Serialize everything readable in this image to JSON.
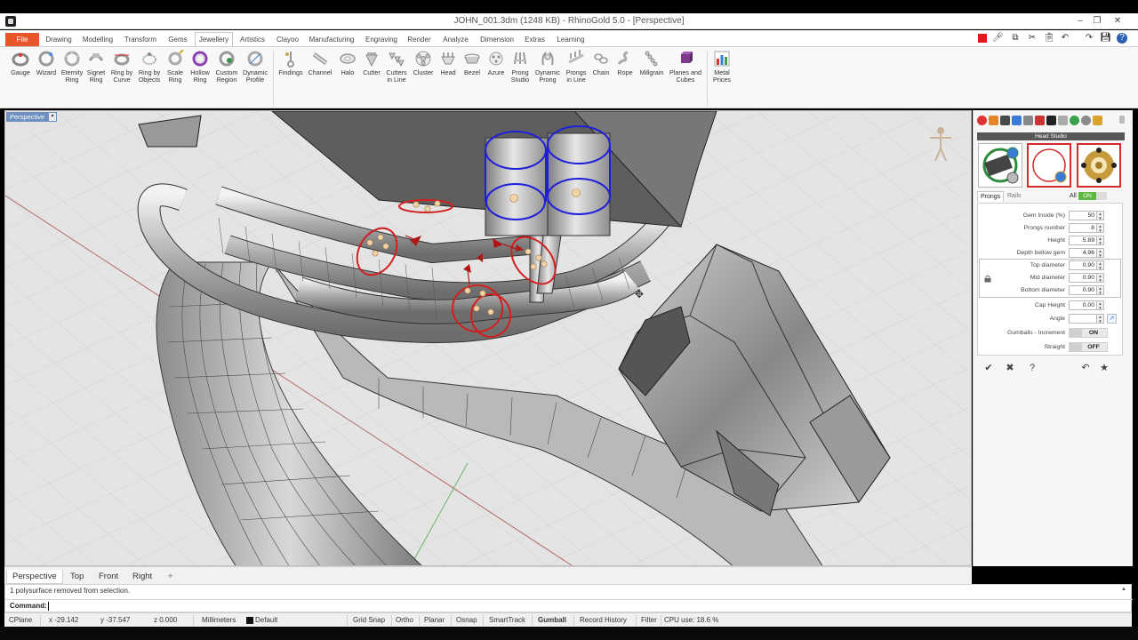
{
  "window": {
    "title": "JOHN_001.3dm (1248 KB) - RhinoGold 5.0 - [Perspective]",
    "min": "–",
    "max": "❐",
    "close": "✕"
  },
  "menu": {
    "file": "File",
    "tabs": [
      "Drawing",
      "Modelling",
      "Transform",
      "Gems",
      "Jewellery",
      "Artistics",
      "Clayoo",
      "Manufacturing",
      "Engraving",
      "Render",
      "Analyze",
      "Dimension",
      "Extras",
      "Learning"
    ],
    "active_tab": "Jewellery",
    "right_icons": [
      "stop-icon",
      "mic-icon",
      "copy-icon",
      "cut-icon",
      "paste-icon",
      "undo-icon",
      "redo-icon",
      "save-icon",
      "help-icon"
    ]
  },
  "ribbon": {
    "groups": [
      {
        "items": [
          {
            "l1": "Gauge",
            "l2": ""
          },
          {
            "l1": "Wizard",
            "l2": ""
          },
          {
            "l1": "Eternity",
            "l2": "Ring"
          },
          {
            "l1": "Signet",
            "l2": "Ring"
          },
          {
            "l1": "Ring by",
            "l2": "Curve"
          },
          {
            "l1": "Ring by",
            "l2": "Objects"
          },
          {
            "l1": "Scale",
            "l2": "Ring"
          },
          {
            "l1": "Hollow",
            "l2": "Ring"
          },
          {
            "l1": "Custom",
            "l2": "Region"
          },
          {
            "l1": "Dynamic",
            "l2": "Profile"
          }
        ]
      },
      {
        "items": [
          {
            "l1": "Findings",
            "l2": ""
          },
          {
            "l1": "Channel",
            "l2": ""
          },
          {
            "l1": "Halo",
            "l2": ""
          },
          {
            "l1": "Cutter",
            "l2": ""
          },
          {
            "l1": "Cutters",
            "l2": "in Line"
          },
          {
            "l1": "Cluster",
            "l2": ""
          },
          {
            "l1": "Head",
            "l2": ""
          },
          {
            "l1": "Bezel",
            "l2": ""
          },
          {
            "l1": "Azure",
            "l2": ""
          },
          {
            "l1": "Prong",
            "l2": "Studio"
          },
          {
            "l1": "Dynamic",
            "l2": "Prong"
          },
          {
            "l1": "Prongs",
            "l2": "in Line"
          },
          {
            "l1": "Chain",
            "l2": ""
          },
          {
            "l1": "Rope",
            "l2": ""
          },
          {
            "l1": "Millgrain",
            "l2": ""
          },
          {
            "l1": "Planes and",
            "l2": "Cubes"
          }
        ]
      },
      {
        "items": [
          {
            "l1": "Metal",
            "l2": "Prices"
          }
        ]
      }
    ]
  },
  "viewport": {
    "label": "Perspective",
    "dropdown": "▾"
  },
  "panel": {
    "title": "Head Studio",
    "tabs": [
      "Prongs",
      "Rails"
    ],
    "all_label": "All",
    "all_state": "ON",
    "fields": [
      {
        "label": "Gem Inside (%)",
        "value": "50"
      },
      {
        "label": "Prongs number",
        "value": "8"
      },
      {
        "label": "Height",
        "value": "5.89"
      },
      {
        "label": "Depth bellow gem",
        "value": "4.96"
      },
      {
        "label": "Top diameter",
        "value": "0.90"
      },
      {
        "label": "Mid diameter",
        "value": "0.90"
      },
      {
        "label": "Bottom diameter",
        "value": "0.90"
      },
      {
        "label": "Cap Height",
        "value": "0.00"
      },
      {
        "label": "Angle",
        "value": ""
      }
    ],
    "toggles": [
      {
        "label": "Gumballs - Increment",
        "value": "ON"
      },
      {
        "label": "Straight",
        "value": "OFF"
      }
    ],
    "actions": [
      "✔",
      "✖",
      "?",
      "↶",
      "★"
    ]
  },
  "view_tabs": [
    "Perspective",
    "Top",
    "Front",
    "Right",
    "⌖"
  ],
  "command": {
    "history": "1 polysurface removed from selection.",
    "label": "Command:",
    "value": ""
  },
  "status": {
    "cplane": "CPlane",
    "x": "x -29.142",
    "y": "y -37.547",
    "z": "z 0.000",
    "units": "Millimeters",
    "layer": "Default",
    "toggles": [
      "Grid Snap",
      "Ortho",
      "Planar",
      "Osnap",
      "SmartTrack",
      "Gumball",
      "Record History",
      "Filter"
    ],
    "active_toggle": "Gumball",
    "cpu": "CPU use: 18.6 %"
  },
  "colors": {
    "file_tab": "#e8562b",
    "viewport_bg": "#e4e4e4",
    "prong_select": "#1f1fd9",
    "gumball": "#d21f1f",
    "on_green": "#5fb842"
  }
}
